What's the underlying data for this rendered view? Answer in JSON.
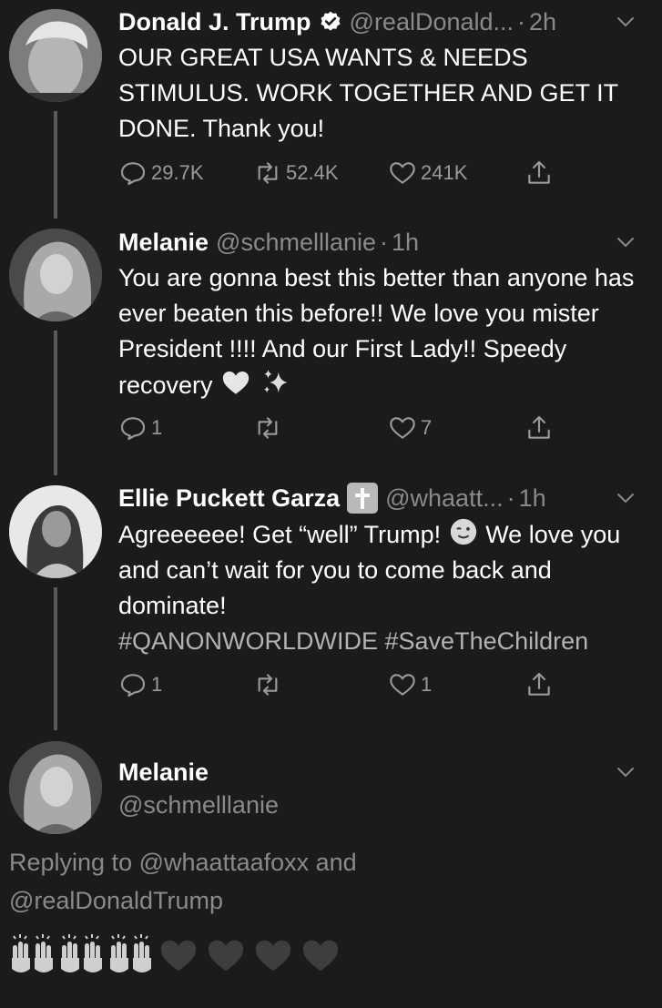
{
  "tweets": [
    {
      "name": "Donald J. Trump",
      "handle": "@realDonald...",
      "dot": "·",
      "time": "2h",
      "text": "OUR GREAT USA WANTS & NEEDS STIMULUS. WORK TOGETHER AND GET IT DONE. Thank you!",
      "replies": "29.7K",
      "retweets": "52.4K",
      "likes": "241K"
    },
    {
      "name": "Melanie",
      "handle": "@schmelllanie",
      "dot": "·",
      "time": "1h",
      "text": "You are gonna best this better than anyone has ever beaten this before!! We love you mister President !!!! And our First Lady!! Speedy recovery",
      "replies": "1",
      "retweets": "",
      "likes": "7"
    },
    {
      "name": "Ellie Puckett Garza",
      "handle": "@whaatt...",
      "dot": "·",
      "time": "1h",
      "text_a": "Agreeeeee! Get “well” Trump!",
      "text_b": "We love you and can’t wait for you to come back and dominate!",
      "hashtags": "#QANONWORLDWIDE #SaveTheChildren",
      "replies": "1",
      "retweets": "",
      "likes": "1"
    },
    {
      "name": "Melanie",
      "handle": "@schmelllanie",
      "replying_prefix": "Replying to",
      "replying_user1": "@whaattaafoxx",
      "replying_and": "and",
      "replying_user2": "@realDonaldTrump",
      "emojis": [
        "raising-hands",
        "raising-hands",
        "raising-hands",
        "black-heart",
        "black-heart",
        "black-heart",
        "black-heart"
      ]
    }
  ],
  "colors": {
    "background": "#1b1b1b",
    "text": "#ffffff",
    "muted": "#8a8a8a",
    "thread_line": "#5a5a5a"
  }
}
